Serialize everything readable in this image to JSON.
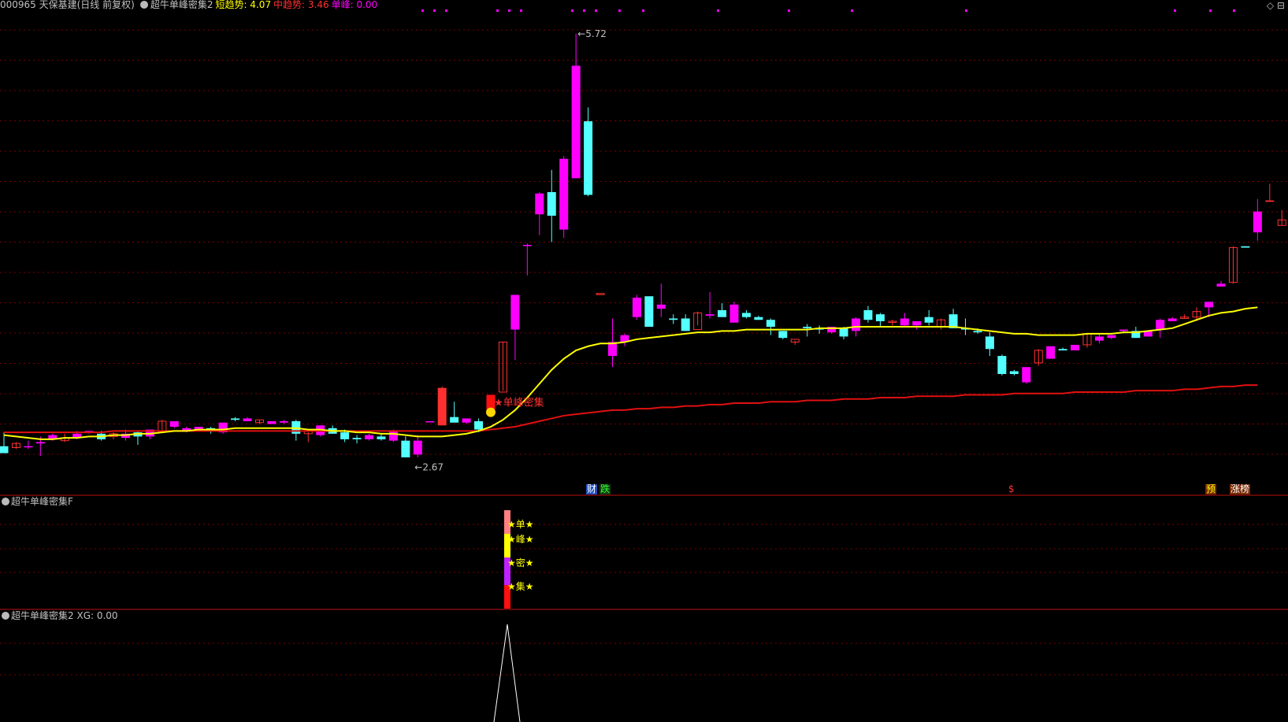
{
  "header": {
    "code_title": "000965 天保基建(日线 前复权)",
    "indicator_name": "超牛单峰密集2",
    "short_trend_label": "短趋势: 4.07",
    "mid_trend_label": "中趋势: 3.46",
    "single_peak_label": "单峰: 0.00"
  },
  "colors": {
    "background": "#000000",
    "grid": "#7a0000",
    "up_candle": "#ff00ff",
    "down_candle": "#54ffff",
    "up_hollow": "#ff3030",
    "short_ma": "#ffff00",
    "long_ma": "#e01010",
    "short_label": "#ffff00",
    "mid_label": "#ff3030",
    "peak_label": "#ff00ff"
  },
  "annotations": {
    "high_label": "5.72",
    "low_label": "2.67",
    "signal_label": "★单峰密集",
    "signal_icon": "money-bag-icon"
  },
  "events": [
    {
      "text": "财",
      "color": "#ffffff",
      "bg": "#1e4dbb"
    },
    {
      "text": "跌",
      "color": "#30ff30",
      "bg": "#123e12"
    },
    {
      "text": "$",
      "color": "#ff3030",
      "bg": ""
    },
    {
      "text": "预",
      "color": "#ffff00",
      "bg": "#7a2a00"
    },
    {
      "text": "涨榜",
      "color": "#ffffff",
      "bg": "#7a2a00"
    }
  ],
  "panel2": {
    "title": "超牛单峰密集F",
    "labels": [
      "★单★",
      "★峰★",
      "★密★",
      "★集★"
    ]
  },
  "panel3": {
    "title": "超牛单峰密集2",
    "xg_label": "XG: 0.00"
  },
  "corner_icon": "diamond-icon",
  "chart_data": {
    "type": "candlestick",
    "price_range": [
      2.55,
      5.85
    ],
    "candles": [
      [
        2.75,
        2.85,
        2.7,
        2.7
      ],
      [
        2.74,
        2.78,
        2.73,
        2.77
      ],
      [
        2.75,
        2.79,
        2.73,
        2.75
      ],
      [
        2.77,
        2.82,
        2.68,
        2.78
      ],
      [
        2.8,
        2.84,
        2.79,
        2.83
      ],
      [
        2.79,
        2.84,
        2.78,
        2.81
      ],
      [
        2.81,
        2.86,
        2.8,
        2.84
      ],
      [
        2.85,
        2.86,
        2.84,
        2.86
      ],
      [
        2.84,
        2.86,
        2.79,
        2.8
      ],
      [
        2.82,
        2.85,
        2.8,
        2.84
      ],
      [
        2.81,
        2.87,
        2.79,
        2.84
      ],
      [
        2.85,
        2.86,
        2.76,
        2.82
      ],
      [
        2.82,
        2.87,
        2.8,
        2.87
      ],
      [
        2.86,
        2.94,
        2.85,
        2.93
      ],
      [
        2.89,
        2.93,
        2.88,
        2.93
      ],
      [
        2.86,
        2.89,
        2.85,
        2.88
      ],
      [
        2.86,
        2.89,
        2.86,
        2.89
      ],
      [
        2.88,
        2.89,
        2.84,
        2.86
      ],
      [
        2.85,
        2.92,
        2.84,
        2.92
      ],
      [
        2.95,
        2.96,
        2.93,
        2.94
      ],
      [
        2.93,
        2.96,
        2.93,
        2.95
      ],
      [
        2.92,
        2.94,
        2.91,
        2.94
      ],
      [
        2.91,
        2.93,
        2.91,
        2.93
      ],
      [
        2.92,
        2.94,
        2.91,
        2.93
      ],
      [
        2.93,
        2.94,
        2.79,
        2.84
      ],
      [
        2.84,
        2.85,
        2.78,
        2.86
      ],
      [
        2.83,
        2.9,
        2.82,
        2.9
      ],
      [
        2.88,
        2.9,
        2.84,
        2.84
      ],
      [
        2.85,
        2.87,
        2.78,
        2.8
      ],
      [
        2.81,
        2.83,
        2.77,
        2.8
      ],
      [
        2.8,
        2.84,
        2.79,
        2.83
      ],
      [
        2.82,
        2.84,
        2.79,
        2.8
      ],
      [
        2.79,
        2.87,
        2.78,
        2.86
      ],
      [
        2.79,
        2.82,
        2.67,
        2.67
      ],
      [
        2.69,
        2.83,
        2.67,
        2.79
      ],
      [
        2.93,
        2.93,
        2.93,
        2.93
      ],
      [
        2.9,
        3.18,
        2.9,
        3.17
      ],
      [
        2.96,
        3.07,
        2.94,
        2.92
      ],
      [
        2.92,
        2.95,
        2.91,
        2.95
      ],
      [
        2.93,
        2.95,
        2.85,
        2.87
      ],
      [
        3.12,
        3.12,
        3.01,
        3.01
      ],
      [
        3.14,
        3.5,
        3.15,
        3.5
      ],
      [
        3.59,
        3.84,
        3.37,
        3.84
      ],
      [
        4.2,
        4.21,
        3.98,
        4.2
      ],
      [
        4.42,
        4.58,
        4.27,
        4.57
      ],
      [
        4.58,
        4.74,
        4.22,
        4.41
      ],
      [
        4.31,
        4.84,
        4.25,
        4.82
      ],
      [
        4.68,
        5.72,
        4.68,
        5.49
      ],
      [
        5.09,
        5.19,
        4.55,
        4.56
      ],
      [
        3.85,
        3.85,
        3.85,
        3.85
      ],
      [
        3.4,
        3.67,
        3.32,
        3.5
      ],
      [
        3.5,
        3.56,
        3.47,
        3.55
      ],
      [
        3.68,
        3.84,
        3.66,
        3.82
      ],
      [
        3.83,
        3.82,
        3.8,
        3.61
      ],
      [
        3.74,
        3.92,
        3.68,
        3.77
      ],
      [
        3.67,
        3.7,
        3.63,
        3.66
      ],
      [
        3.67,
        3.7,
        3.58,
        3.58
      ],
      [
        3.59,
        3.72,
        3.62,
        3.71
      ],
      [
        3.69,
        3.86,
        3.67,
        3.7
      ],
      [
        3.73,
        3.78,
        3.68,
        3.68
      ],
      [
        3.64,
        3.79,
        3.65,
        3.77
      ],
      [
        3.71,
        3.73,
        3.67,
        3.68
      ],
      [
        3.68,
        3.69,
        3.66,
        3.66
      ],
      [
        3.66,
        3.67,
        3.55,
        3.61
      ],
      [
        3.58,
        3.58,
        3.52,
        3.53
      ],
      [
        3.5,
        3.51,
        3.48,
        3.52
      ],
      [
        3.61,
        3.63,
        3.54,
        3.6
      ],
      [
        3.6,
        3.62,
        3.56,
        3.59
      ],
      [
        3.57,
        3.6,
        3.56,
        3.61
      ],
      [
        3.6,
        3.61,
        3.52,
        3.54
      ],
      [
        3.58,
        3.68,
        3.54,
        3.67
      ],
      [
        3.73,
        3.76,
        3.64,
        3.66
      ],
      [
        3.7,
        3.71,
        3.61,
        3.65
      ],
      [
        3.65,
        3.66,
        3.62,
        3.65
      ],
      [
        3.62,
        3.71,
        3.61,
        3.67
      ],
      [
        3.62,
        3.64,
        3.59,
        3.65
      ],
      [
        3.68,
        3.73,
        3.62,
        3.64
      ],
      [
        3.61,
        3.67,
        3.59,
        3.66
      ],
      [
        3.7,
        3.74,
        3.6,
        3.6
      ],
      [
        3.6,
        3.67,
        3.55,
        3.59
      ],
      [
        3.58,
        3.6,
        3.56,
        3.57
      ],
      [
        3.54,
        3.57,
        3.4,
        3.45
      ],
      [
        3.4,
        3.41,
        3.26,
        3.27
      ],
      [
        3.29,
        3.3,
        3.26,
        3.27
      ],
      [
        3.21,
        3.31,
        3.2,
        3.32
      ],
      [
        3.35,
        3.45,
        3.33,
        3.44
      ],
      [
        3.38,
        3.47,
        3.39,
        3.47
      ],
      [
        3.45,
        3.46,
        3.44,
        3.44
      ],
      [
        3.44,
        3.47,
        3.45,
        3.48
      ],
      [
        3.48,
        3.56,
        3.46,
        3.56
      ],
      [
        3.51,
        3.56,
        3.49,
        3.54
      ],
      [
        3.53,
        3.55,
        3.52,
        3.55
      ],
      [
        3.58,
        3.59,
        3.56,
        3.59
      ],
      [
        3.58,
        3.61,
        3.53,
        3.53
      ],
      [
        3.54,
        3.57,
        3.56,
        3.58
      ],
      [
        3.59,
        3.67,
        3.53,
        3.66
      ],
      [
        3.65,
        3.68,
        3.65,
        3.67
      ],
      [
        3.67,
        3.7,
        3.67,
        3.68
      ],
      [
        3.68,
        3.75,
        3.65,
        3.72
      ],
      [
        3.75,
        3.79,
        3.68,
        3.79
      ],
      [
        3.9,
        3.94,
        3.92,
        3.92
      ],
      [
        3.93,
        4.19,
        3.92,
        4.18
      ],
      [
        4.19,
        4.19,
        4.19,
        4.18
      ],
      [
        4.29,
        4.53,
        4.23,
        4.44
      ],
      [
        4.51,
        4.64,
        4.52,
        4.52
      ],
      [
        4.34,
        4.45,
        4.34,
        4.38
      ],
      [
        4.35,
        4.36,
        4.35,
        4.36
      ],
      [
        4.38,
        4.45,
        4.34,
        4.39
      ],
      [
        4.37,
        4.39,
        4.35,
        4.36
      ]
    ],
    "ma_short": [
      2.83,
      2.82,
      2.81,
      2.8,
      2.8,
      2.81,
      2.81,
      2.82,
      2.82,
      2.83,
      2.83,
      2.84,
      2.84,
      2.85,
      2.86,
      2.86,
      2.87,
      2.87,
      2.87,
      2.88,
      2.88,
      2.88,
      2.88,
      2.88,
      2.88,
      2.87,
      2.87,
      2.86,
      2.86,
      2.85,
      2.85,
      2.84,
      2.84,
      2.83,
      2.82,
      2.82,
      2.82,
      2.83,
      2.84,
      2.86,
      2.89,
      2.94,
      3.01,
      3.1,
      3.2,
      3.3,
      3.38,
      3.44,
      3.47,
      3.49,
      3.49,
      3.5,
      3.52,
      3.53,
      3.54,
      3.55,
      3.56,
      3.57,
      3.57,
      3.58,
      3.58,
      3.59,
      3.59,
      3.59,
      3.59,
      3.59,
      3.59,
      3.6,
      3.6,
      3.6,
      3.61,
      3.61,
      3.61,
      3.61,
      3.61,
      3.61,
      3.61,
      3.61,
      3.61,
      3.6,
      3.59,
      3.58,
      3.57,
      3.56,
      3.56,
      3.55,
      3.55,
      3.55,
      3.55,
      3.56,
      3.56,
      3.56,
      3.57,
      3.57,
      3.58,
      3.59,
      3.6,
      3.63,
      3.66,
      3.69,
      3.71,
      3.72,
      3.74,
      3.75
    ],
    "ma_long": [
      2.85,
      2.85,
      2.85,
      2.85,
      2.85,
      2.85,
      2.85,
      2.85,
      2.85,
      2.86,
      2.86,
      2.86,
      2.86,
      2.86,
      2.86,
      2.86,
      2.86,
      2.86,
      2.86,
      2.86,
      2.86,
      2.86,
      2.86,
      2.86,
      2.86,
      2.86,
      2.86,
      2.86,
      2.86,
      2.86,
      2.86,
      2.86,
      2.86,
      2.86,
      2.86,
      2.86,
      2.86,
      2.86,
      2.86,
      2.86,
      2.87,
      2.88,
      2.89,
      2.91,
      2.93,
      2.95,
      2.97,
      2.98,
      2.99,
      3.0,
      3.01,
      3.01,
      3.02,
      3.02,
      3.03,
      3.03,
      3.04,
      3.04,
      3.05,
      3.05,
      3.06,
      3.06,
      3.06,
      3.07,
      3.07,
      3.07,
      3.08,
      3.08,
      3.08,
      3.09,
      3.09,
      3.09,
      3.1,
      3.1,
      3.1,
      3.11,
      3.11,
      3.11,
      3.11,
      3.12,
      3.12,
      3.12,
      3.12,
      3.13,
      3.13,
      3.13,
      3.13,
      3.13,
      3.14,
      3.14,
      3.14,
      3.14,
      3.14,
      3.15,
      3.15,
      3.15,
      3.15,
      3.16,
      3.16,
      3.17,
      3.18,
      3.18,
      3.19,
      3.19
    ],
    "signal_index": 40,
    "signal_value": 0
  }
}
